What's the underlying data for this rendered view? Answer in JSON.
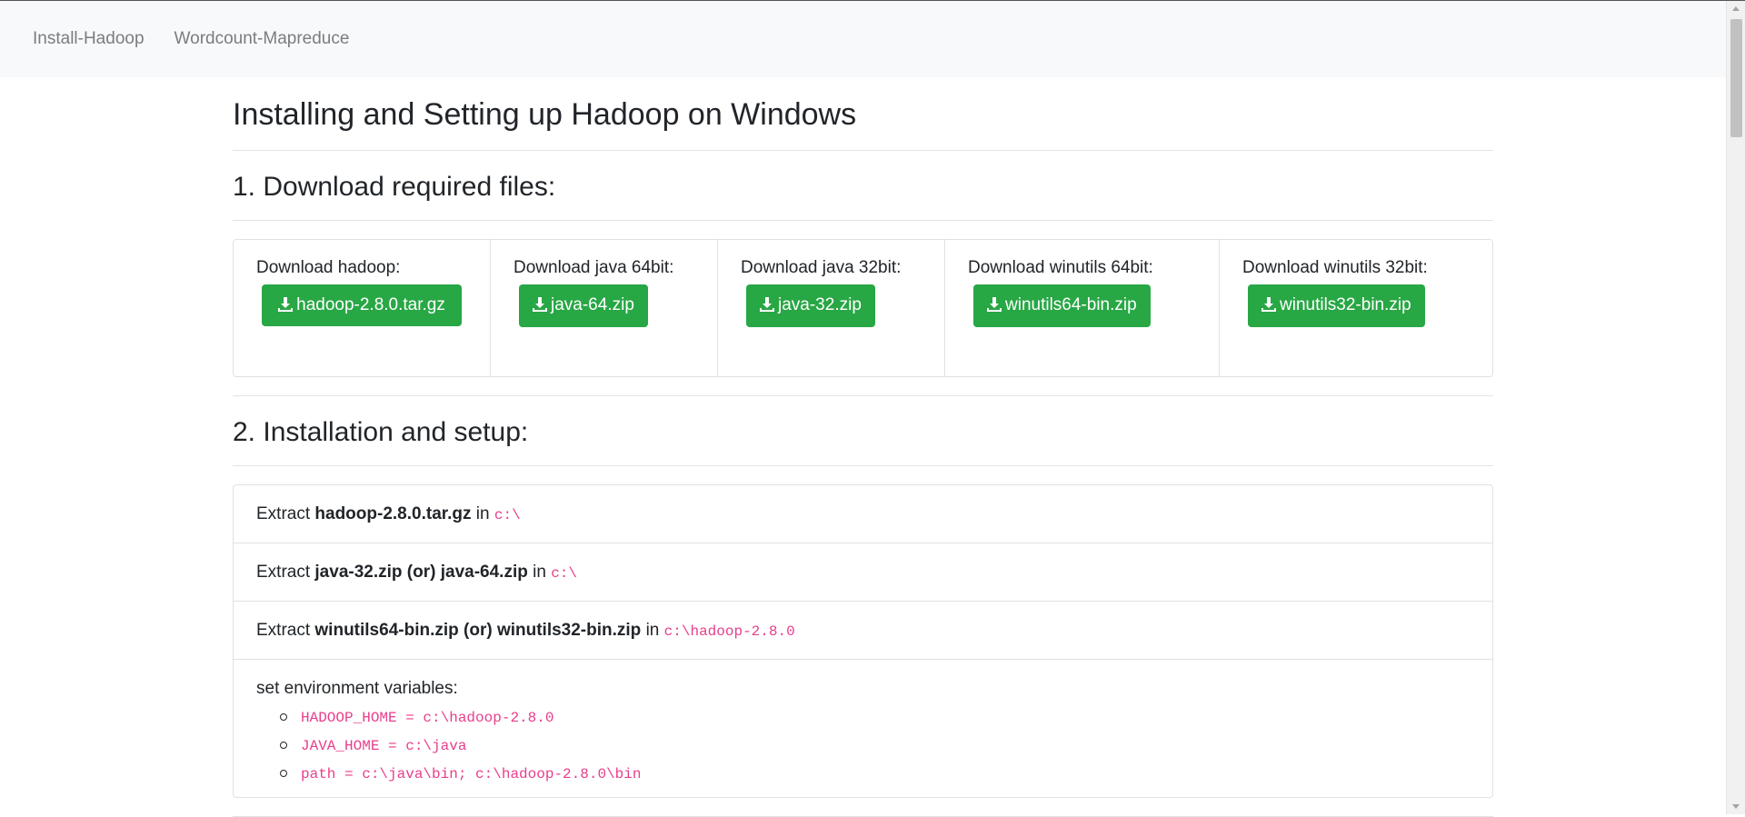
{
  "nav": {
    "items": [
      {
        "label": "Install-Hadoop"
      },
      {
        "label": "Wordcount-Mapreduce"
      }
    ]
  },
  "page_title": "Installing and Setting up Hadoop on Windows",
  "section1": {
    "title": "1. Download required files:",
    "downloads": [
      {
        "label": "Download hadoop:",
        "button": "hadoop-2.8.0.tar.gz"
      },
      {
        "label": "Download java 64bit:",
        "button": "java-64.zip"
      },
      {
        "label": "Download java 32bit:",
        "button": "java-32.zip"
      },
      {
        "label": "Download winutils 64bit:",
        "button": "winutils64-bin.zip"
      },
      {
        "label": "Download winutils 32bit:",
        "button": "winutils32-bin.zip"
      }
    ]
  },
  "section2": {
    "title": "2. Installation and setup:",
    "steps": [
      {
        "prefix": "Extract",
        "file": "hadoop-2.8.0.tar.gz",
        "mid": "in",
        "path": "c:\\"
      },
      {
        "prefix": "Extract",
        "file": "java-32.zip (or) java-64.zip",
        "mid": "in",
        "path": "c:\\"
      },
      {
        "prefix": "Extract",
        "file": "winutils64-bin.zip (or) winutils32-bin.zip",
        "mid": "in",
        "path": "c:\\hadoop-2.8.0"
      }
    ],
    "env": {
      "label": "set environment variables:",
      "vars": [
        "HADOOP_HOME = c:\\hadoop-2.8.0",
        "JAVA_HOME = c:\\java",
        "path = c:\\java\\bin; c:\\hadoop-2.8.0\\bin"
      ]
    }
  },
  "colors": {
    "button_green": "#28a745",
    "code_pink": "#e83e8c",
    "navbar_bg": "#f8f9fa"
  },
  "icons": {
    "download": "download-icon"
  }
}
